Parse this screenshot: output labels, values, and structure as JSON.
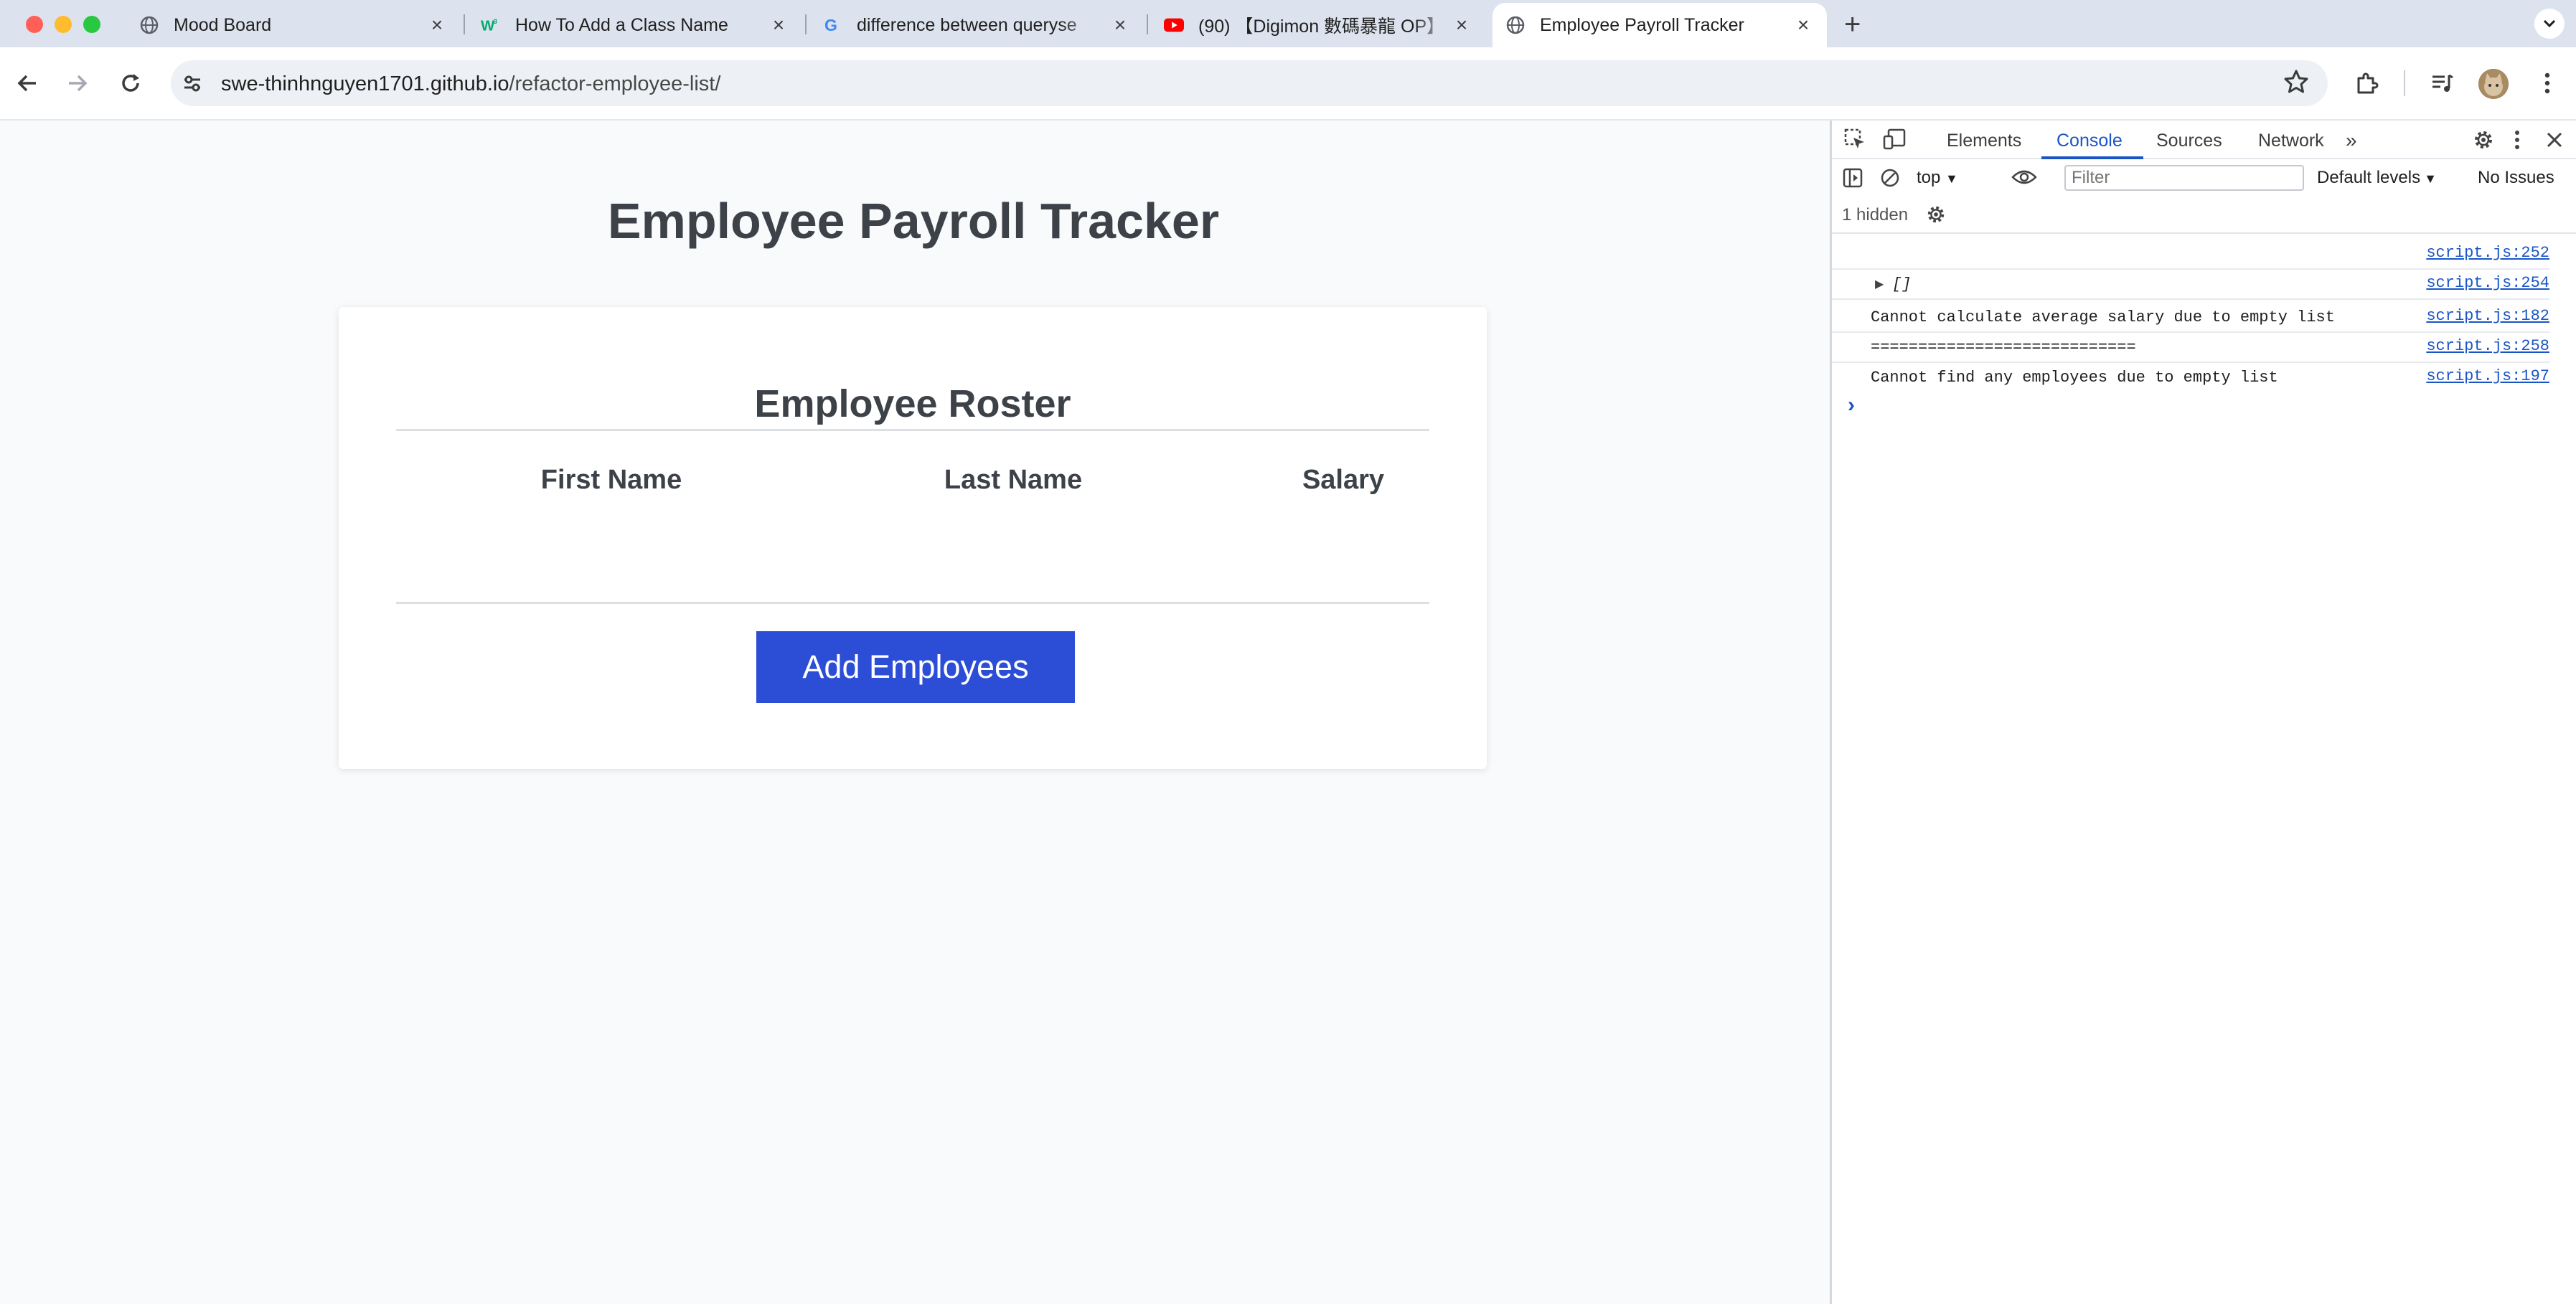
{
  "window": {
    "traffic_lights": [
      "#ff5f57",
      "#febc2e",
      "#28c840"
    ]
  },
  "tabs": [
    {
      "title": "Mood Board",
      "icon": "globe-icon",
      "active": false
    },
    {
      "title": "How To Add a Class Name",
      "icon": "w3schools-icon",
      "active": false
    },
    {
      "title": "difference between queryse",
      "icon": "google-icon",
      "active": false
    },
    {
      "title": "(90) 【Digimon 數碼暴龍 OP】",
      "icon": "youtube-icon",
      "active": false
    },
    {
      "title": "Employee Payroll Tracker",
      "icon": "globe-icon",
      "active": true
    }
  ],
  "toolbar": {
    "url_host": "swe-thinhnguyen1701.github.io",
    "url_path": "/refactor-employee-list/"
  },
  "page": {
    "title": "Employee Payroll Tracker",
    "card": {
      "title": "Employee Roster",
      "columns": [
        "First Name",
        "Last Name",
        "Salary"
      ],
      "rows": [],
      "add_button": "Add Employees"
    }
  },
  "devtools": {
    "tabs": [
      "Elements",
      "Console",
      "Sources",
      "Network"
    ],
    "active_tab": "Console",
    "context": "top",
    "filter_placeholder": "Filter",
    "levels": "Default levels",
    "issues": "No Issues",
    "hidden_count": "1 hidden",
    "messages": [
      {
        "text": "",
        "source": "script.js:252"
      },
      {
        "text": "[]",
        "source": "script.js:254",
        "expandable": true
      },
      {
        "text": "Cannot calculate average salary due to empty list",
        "source": "script.js:182"
      },
      {
        "text": "============================",
        "source": "script.js:258"
      },
      {
        "text": "Cannot find any employees due to empty list",
        "source": "script.js:197"
      }
    ],
    "prompt": "›"
  },
  "colors": {
    "accent": "#2c4ed6",
    "devtools_active": "#1a55c7",
    "heading": "#3d4249"
  }
}
